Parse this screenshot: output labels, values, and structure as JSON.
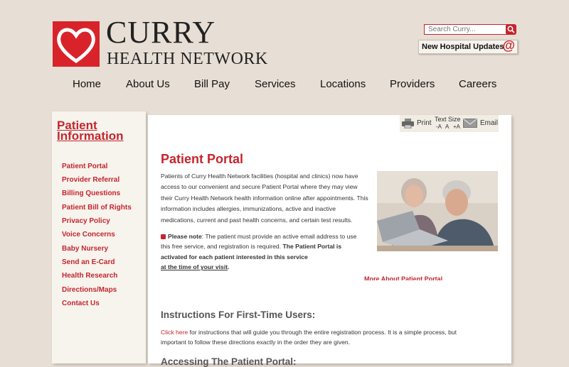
{
  "header": {
    "brand_line1": "CURRY",
    "brand_line2": "HEALTH NETWORK",
    "search_placeholder": "Search Curry...",
    "updates_label": "New Hospital Updates",
    "updates_icon": "@"
  },
  "nav": [
    "Home",
    "About Us",
    "Bill Pay",
    "Services",
    "Locations",
    "Providers",
    "Careers"
  ],
  "sidebar": {
    "title_line1": "Patient",
    "title_line2": "Information",
    "links": [
      "Patient Portal",
      "Provider Referral",
      "Billing Questions",
      "Patient Bill of Rights",
      "Privacy Policy",
      "Voice Concerns",
      "Baby Nursery",
      "Send an E-Card",
      "Health Research",
      "Directions/Maps",
      "Contact Us"
    ]
  },
  "toolbar": {
    "print": "Print",
    "text_size": "Text Size",
    "size_a_minus": "-A",
    "size_a": "A",
    "size_a_plus": "+A",
    "email": "Email"
  },
  "main": {
    "title": "Patient Portal",
    "intro": "Patients of Curry Health Network facilities (hospital and clinics) now have access to our convenient and secure Patient Portal where they may view their Curry Health Network health information online after appointments. This information includes allergies, immunizations, active and inactive medications, current and past health concerns, and certain test results.",
    "note_label": "Please note",
    "note_text": ": The patient must provide an active email address to use this free service, and registration is required. ",
    "note_bold": "The Patient Portal is activated for each patient interested in this service",
    "note_underlined": "at the time of your visit",
    "note_end": ".",
    "more_link": "More About Patient Portal",
    "section1_title": "Instructions For First-Time Users:",
    "click_here": "Click here",
    "instructions": " for instructions that will guide you through the entire registration process. It is a simple process, but important to follow these directions exactly in the order they are given.",
    "section2_title": "Accessing The Patient Portal:"
  },
  "colors": {
    "brand_red": "#c4262e",
    "page_bg": "#e7dfd5"
  }
}
